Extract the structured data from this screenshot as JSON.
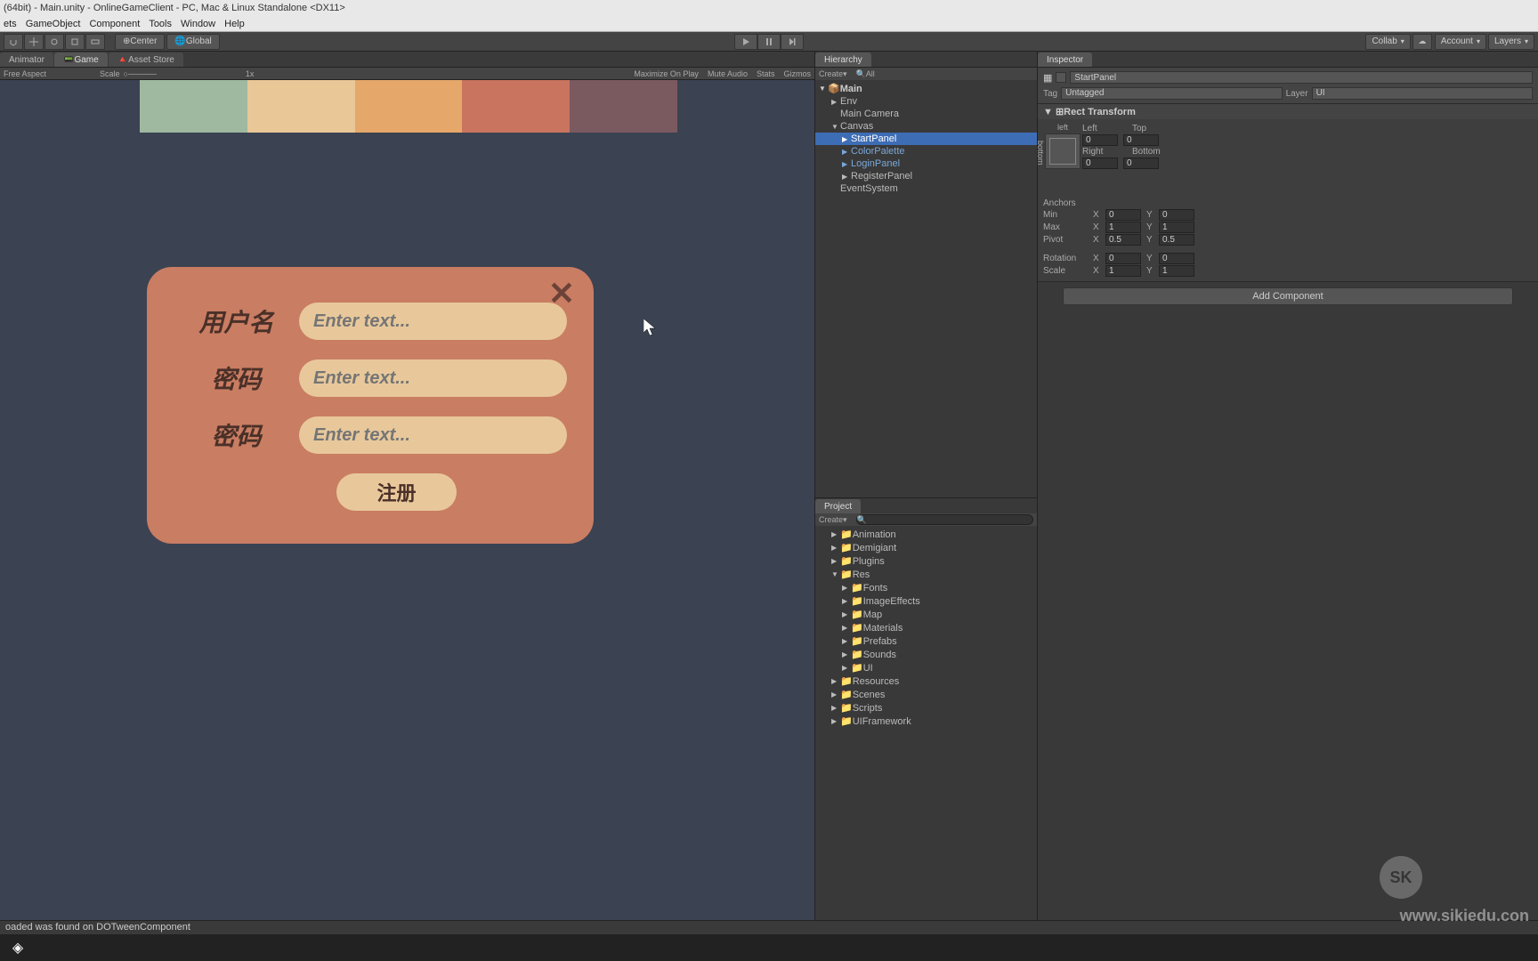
{
  "title": "(64bit) - Main.unity - OnlineGameClient - PC, Mac & Linux Standalone <DX11>",
  "menu": [
    "ets",
    "GameObject",
    "Component",
    "Tools",
    "Window",
    "Help"
  ],
  "toolbar": {
    "center": "Center",
    "global": "Global",
    "collab": "Collab",
    "account": "Account",
    "layers": "Layers"
  },
  "tabs": {
    "animator": "Animator",
    "game": "Game",
    "assetstore": "Asset Store",
    "hierarchy": "Hierarchy",
    "inspector": "Inspector",
    "project": "Project"
  },
  "gameToolbar": {
    "aspect": "Free Aspect",
    "scale": "Scale",
    "zoom": "1x",
    "maximize": "Maximize On Play",
    "mute": "Mute Audio",
    "stats": "Stats",
    "gizmos": "Gizmos"
  },
  "palette": [
    "#9fb8a0",
    "#e9c796",
    "#e5a76a",
    "#c9745f",
    "#7a5a5f"
  ],
  "registerPanel": {
    "usernameLabel": "用户名",
    "passwordLabel": "密码",
    "passwordLabel2": "密码",
    "placeholder": "Enter text...",
    "submit": "注册"
  },
  "hierarchy": {
    "create": "Create",
    "all": "All",
    "scene": "Main",
    "items": [
      "Env",
      "Main Camera",
      "Canvas",
      "StartPanel",
      "ColorPalette",
      "LoginPanel",
      "RegisterPanel",
      "EventSystem"
    ]
  },
  "inspector": {
    "name": "StartPanel",
    "tagLabel": "Tag",
    "tag": "Untagged",
    "layerLabel": "Layer",
    "layer": "UI",
    "rectTransform": "Rect Transform",
    "left": "left",
    "bottom": "bottom",
    "posLeft": "Left",
    "posTop": "Top",
    "posRight": "Right",
    "posBottom": "Bottom",
    "val0": "0",
    "anchors": "Anchors",
    "min": "Min",
    "max": "Max",
    "pivot": "Pivot",
    "rotation": "Rotation",
    "scale": "Scale",
    "minX": "0",
    "minY": "0",
    "maxX": "1",
    "maxY": "1",
    "pivotX": "0.5",
    "pivotY": "0.5",
    "rotX": "0",
    "rotY": "0",
    "scaleX": "1",
    "scaleY": "1",
    "addComponent": "Add Component"
  },
  "project": {
    "create": "Create",
    "items": [
      "Animation",
      "Demigiant",
      "Plugins",
      "Res",
      "Fonts",
      "ImageEffects",
      "Map",
      "Materials",
      "Prefabs",
      "Sounds",
      "UI",
      "Resources",
      "Scenes",
      "Scripts",
      "UIFramework"
    ]
  },
  "console": "oaded was found on DOTweenComponent",
  "watermark": "www.sikiedu.con",
  "watermarkLogo": "SK"
}
